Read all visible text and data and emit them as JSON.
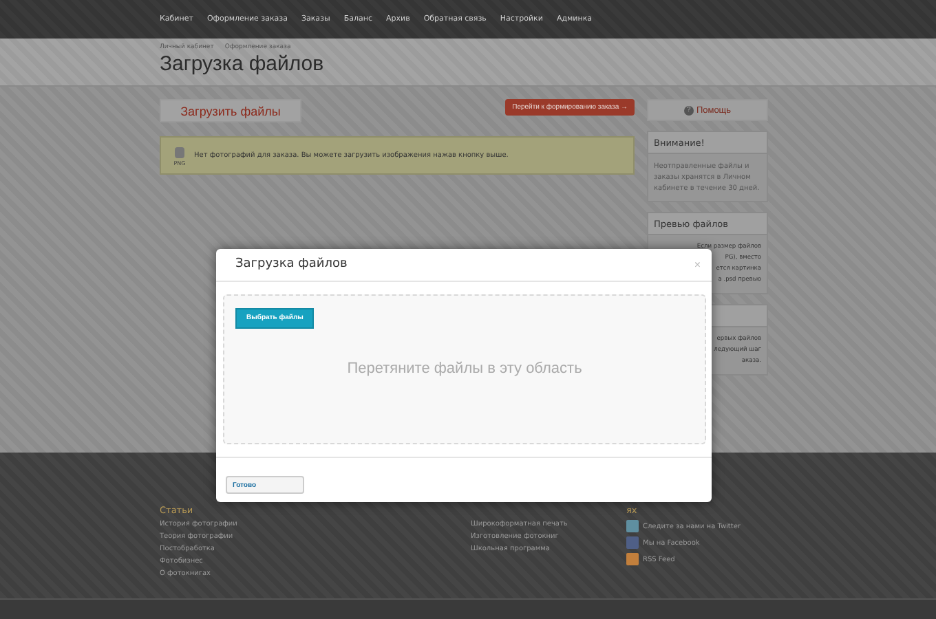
{
  "nav": [
    {
      "label": "Кабинет",
      "selected": false
    },
    {
      "label": "Оформление заказа",
      "selected": false
    },
    {
      "label": "Заказы",
      "selected": false
    },
    {
      "label": "Баланс",
      "selected": false
    },
    {
      "label": "Архив",
      "selected": false
    },
    {
      "label": "Обратная связь",
      "selected": false
    },
    {
      "label": "Настройки",
      "selected": false
    },
    {
      "label": "Админка",
      "selected": false
    }
  ],
  "breadcrumbs": [
    "Личный кабинет",
    "Оформление заказа"
  ],
  "title": "Загрузка файлов",
  "upload_button": "Загрузить файлы",
  "next_button": "Перейти к формированию заказа →",
  "help_button": {
    "icon": "?",
    "label": "Помощь"
  },
  "notice": {
    "icon_label": "PNG",
    "text": "Нет фотографий для заказа. Вы можете загрузить изображения нажав кнопку выше."
  },
  "sidebar": [
    {
      "title": "Внимание!",
      "lines": [
        "Неотправленные файлы и заказы хранятся в Личном кабинете в течение 30 дней."
      ],
      "kind": "full"
    },
    {
      "title": "Превью файлов",
      "lines": [
        "Если размер файлов",
        "PG), вместо",
        "ется картинка",
        "а .psd превью"
      ],
      "kind": "cut"
    },
    {
      "lines": [
        "ервых файлов",
        "ледующий шаг",
        "аказа."
      ],
      "kind": "cut"
    }
  ],
  "modal": {
    "title": "Загрузка файлов",
    "close": "×",
    "choose_button": "Выбрать файлы",
    "drop_hint": "Перетяните файлы в эту область",
    "done_button": "Готово"
  },
  "footer": [
    {
      "title": "Статьи",
      "links": [
        {
          "label": "История фотографии"
        },
        {
          "label": "Теория фотографии"
        },
        {
          "label": "Постобработка"
        },
        {
          "label": "Фотобизнес"
        },
        {
          "label": "О фотокнигах"
        }
      ]
    },
    {
      "links": [
        {
          "label": "Широкоформатная печать"
        },
        {
          "label": "Изготовление фотокниг"
        },
        {
          "label": "Школьная программа"
        }
      ]
    },
    {
      "title": "ях",
      "links": [
        {
          "label": "Следите за нами на Twitter",
          "kind": "twitter"
        },
        {
          "label": "Мы на Facebook",
          "kind": "facebook"
        },
        {
          "label": "RSS Feed",
          "kind": "rss"
        }
      ]
    }
  ]
}
